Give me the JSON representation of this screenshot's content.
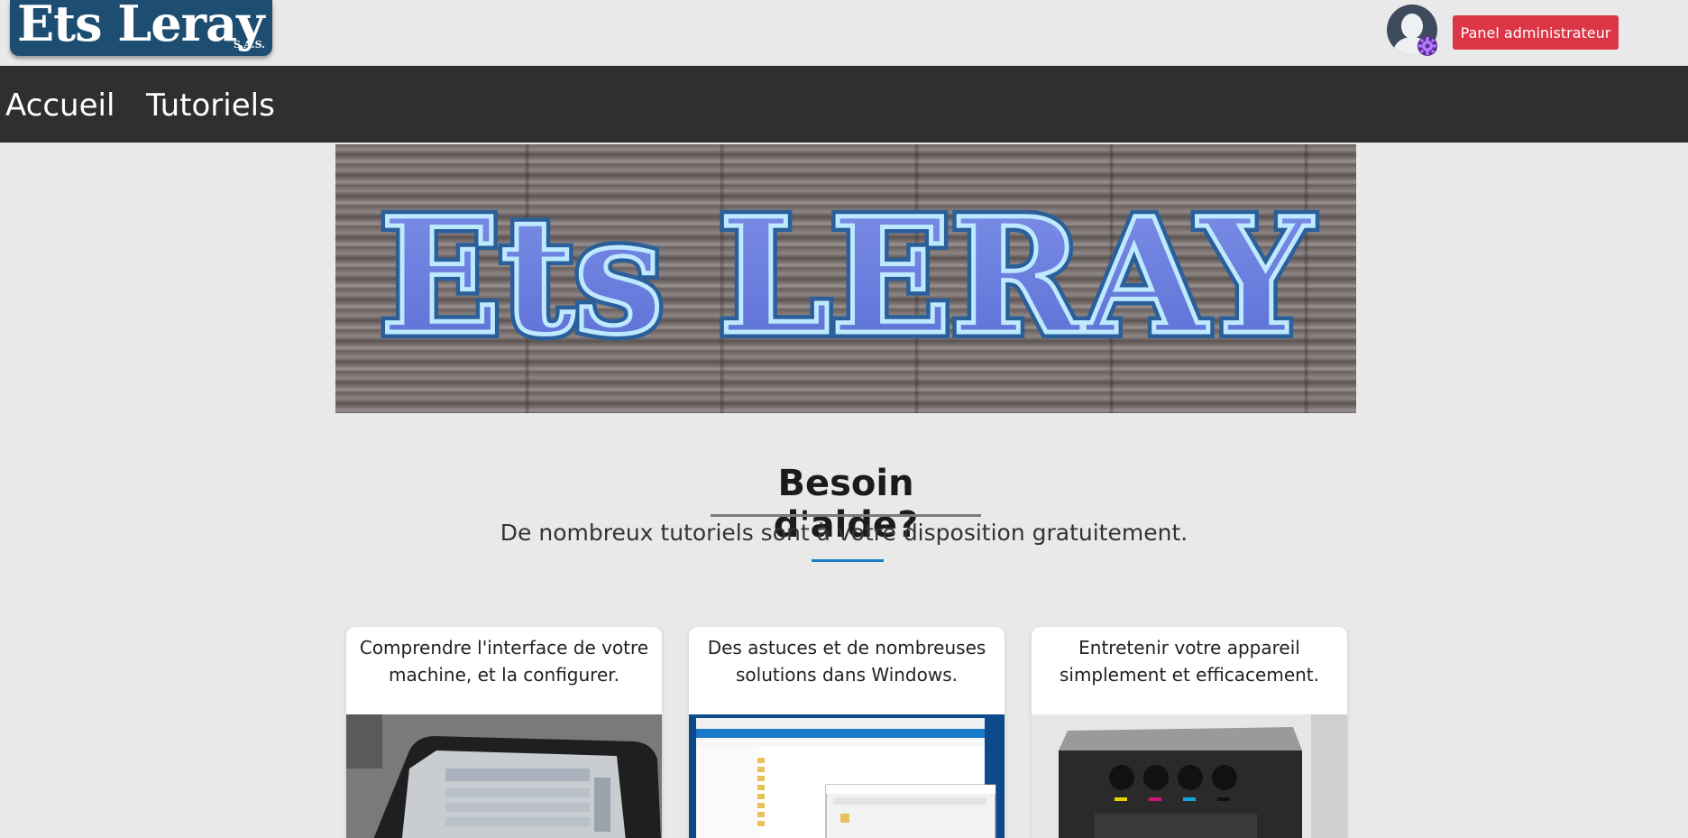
{
  "header": {
    "logo_text": "Ets Leray",
    "logo_suffix": "S.A.S.",
    "avatar_icon": "user-avatar-icon",
    "badge_icon": "gear-icon",
    "admin_button": "Panel administrateur"
  },
  "nav": {
    "items": [
      {
        "label": "Accueil"
      },
      {
        "label": "Tutoriels"
      }
    ]
  },
  "banner": {
    "text": "Ets LERAY"
  },
  "help": {
    "title": "Besoin d'aide?",
    "subtitle": "De nombreux tutoriels sont à votre disposition gratuitement."
  },
  "cards": [
    {
      "text": "Comprendre l'interface de votre machine, et la configurer."
    },
    {
      "text": "Des astuces et de nombreuses solutions dans Windows."
    },
    {
      "text": "Entretenir votre appareil simplement et efficacement."
    }
  ],
  "colors": {
    "brand": "#1d4e72",
    "admin_button": "#dc3545",
    "navbar": "#2f2f2f",
    "accent_rule": "#1a7fc2"
  }
}
